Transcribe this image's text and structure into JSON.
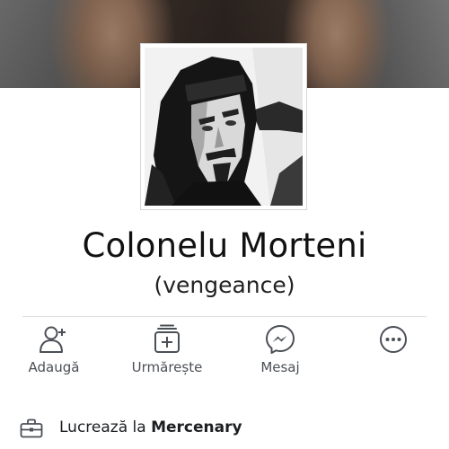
{
  "profile": {
    "name": "Colonelu Morteni",
    "nickname": "(vengeance)"
  },
  "actions": [
    {
      "label": "Adaugă",
      "icon": "add-friend-icon"
    },
    {
      "label": "Urmărește",
      "icon": "follow-icon"
    },
    {
      "label": "Mesaj",
      "icon": "messenger-icon"
    },
    {
      "label": "",
      "icon": "more-icon"
    }
  ],
  "work": {
    "prefix": "Lucrează la",
    "company": "Mercenary",
    "icon": "briefcase-icon"
  },
  "colors": {
    "icon_gray": "#4b4f56",
    "divider": "#dddfe2"
  }
}
